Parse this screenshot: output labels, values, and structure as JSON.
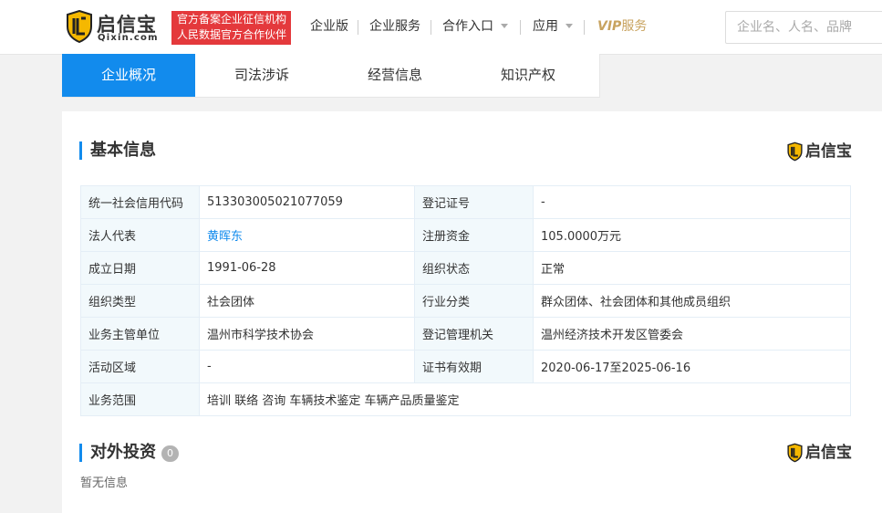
{
  "header": {
    "logo_cn": "启信宝",
    "logo_en": "Qixin.com",
    "badge_line1": "官方备案企业征信机构",
    "badge_line2": "人民数据官方合作伙伴",
    "nav": {
      "enterprise_edition": "企业版",
      "enterprise_services": "企业服务",
      "cooperation": "合作入口",
      "apps": "应用",
      "vip": "VIP",
      "vip_service": "服务"
    },
    "search_placeholder": "企业名、人名、品牌"
  },
  "tabs": [
    {
      "label": "企业概况",
      "active": true
    },
    {
      "label": "司法涉诉",
      "active": false
    },
    {
      "label": "经营信息",
      "active": false
    },
    {
      "label": "知识产权",
      "active": false
    }
  ],
  "basic_info": {
    "title": "基本信息",
    "brand": "启信宝",
    "rows": [
      {
        "l1": "统一社会信用代码",
        "v1": "51330300502107705​9",
        "l2": "登记证号",
        "v2": "-"
      },
      {
        "l1": "法人代表",
        "v1": "黄晖东",
        "l2": "注册资金",
        "v2": "105.0000万元"
      },
      {
        "l1": "成立日期",
        "v1": "1991-06-28",
        "l2": "组织状态",
        "v2": "正常"
      },
      {
        "l1": "组织类型",
        "v1": "社会团体",
        "l2": "行业分类",
        "v2": "群众团体、社会团体和其他成员组织"
      },
      {
        "l1": "业务主管单位",
        "v1": "温州市科学技术协会",
        "l2": "登记管理机关",
        "v2": "温州经济技术开发区管委会"
      },
      {
        "l1": "活动区域",
        "v1": "-",
        "l2": "证书有效期",
        "v2": "2020-06-17至2025-06-16"
      }
    ],
    "scope_label": "业务范围",
    "scope_value": "培训 联络 咨询 车辆技术鉴定 车辆产品质量鉴定"
  },
  "investment": {
    "title": "对外投资",
    "count": "0",
    "brand": "启信宝",
    "empty_text": "暂无信息"
  },
  "colors": {
    "accent": "#128bed",
    "badge_red": "#e4393c",
    "vip_gold": "#c8a35f",
    "label_bg": "#f2f9fc"
  }
}
